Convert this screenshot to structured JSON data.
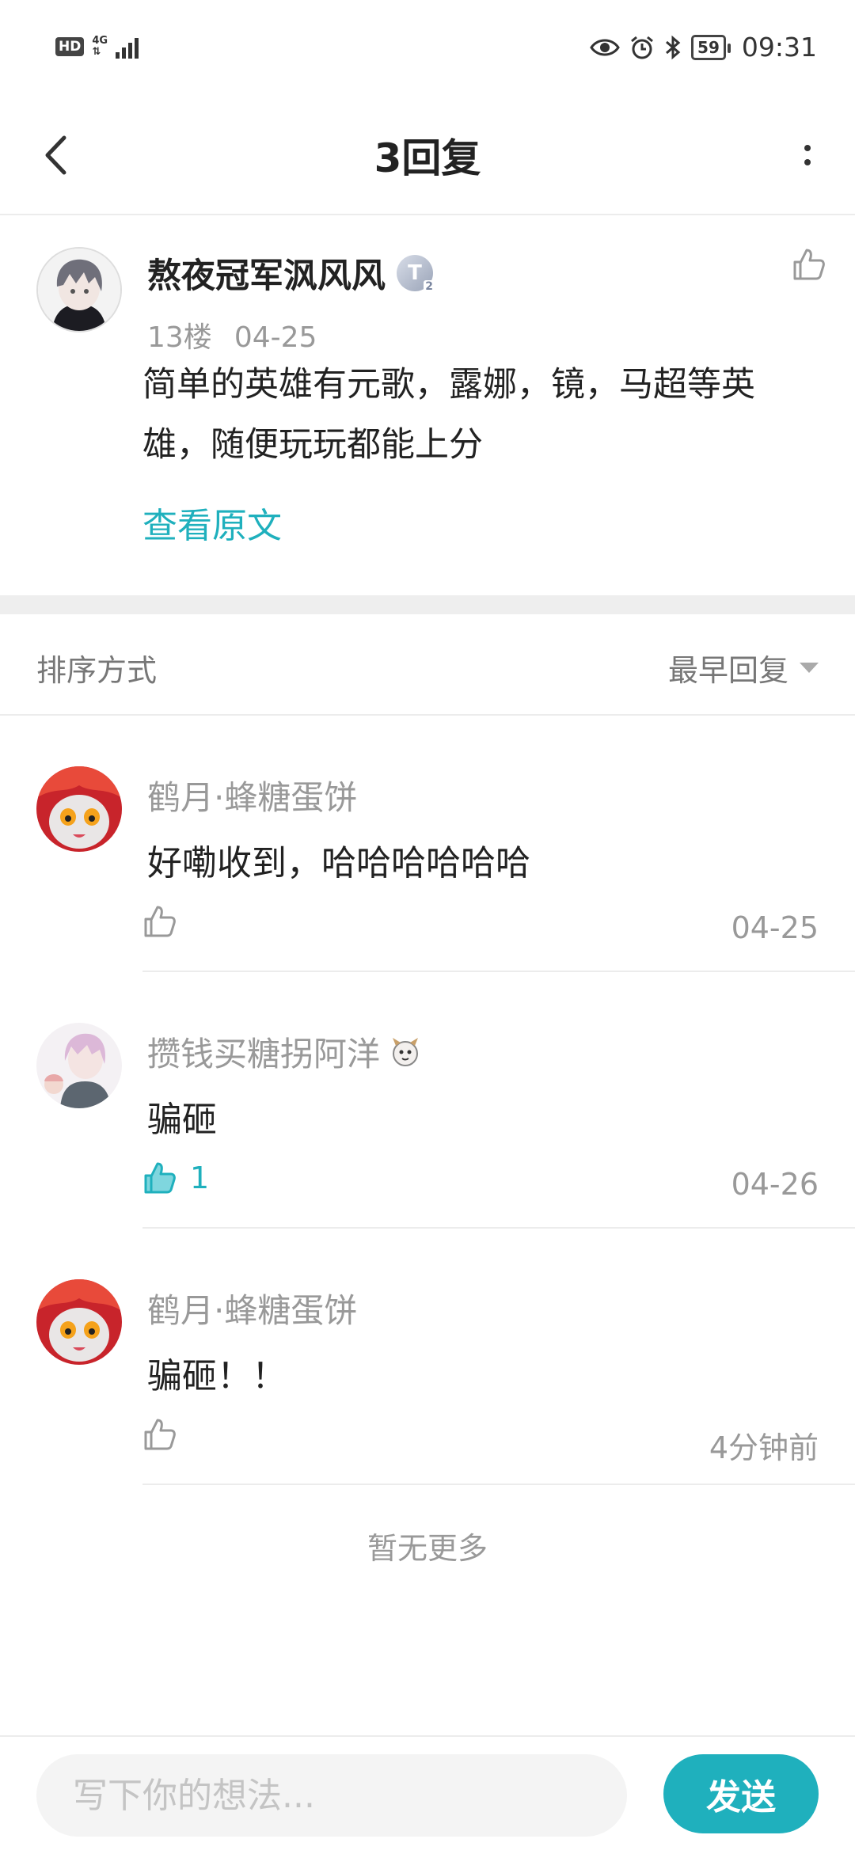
{
  "status_bar": {
    "hd": "HD",
    "network": "4G",
    "time": "09:31",
    "battery": "59",
    "icons": [
      "eye-icon",
      "alarm-icon",
      "bluetooth-icon"
    ]
  },
  "header": {
    "title": "3回复"
  },
  "post": {
    "author": "熬夜冠军沨风风",
    "badge": "T",
    "badge_level": "2",
    "floor": "13楼",
    "date": "04-25",
    "text": "简单的英雄有元歌，露娜，镜，马超等英雄，随便玩玩都能上分",
    "view_original": "查看原文"
  },
  "sort": {
    "label": "排序方式",
    "selected": "最早回复"
  },
  "replies": [
    {
      "author": "鹤月·蜂糖蛋饼",
      "text": "好嘞收到，哈哈哈哈哈哈",
      "likes": "",
      "liked": false,
      "time": "04-25"
    },
    {
      "author": "攒钱买糖拐阿洋",
      "text": "骗砸",
      "likes": "1",
      "liked": true,
      "time": "04-26"
    },
    {
      "author": "鹤月·蜂糖蛋饼",
      "text": "骗砸！！",
      "likes": "",
      "liked": false,
      "time": "4分钟前"
    }
  ],
  "footer_note": "暂无更多",
  "composer": {
    "placeholder": "写下你的想法...",
    "send_label": "发送"
  },
  "colors": {
    "accent": "#1fb0bd",
    "muted_text": "#999999",
    "divider": "#eeeeee"
  }
}
